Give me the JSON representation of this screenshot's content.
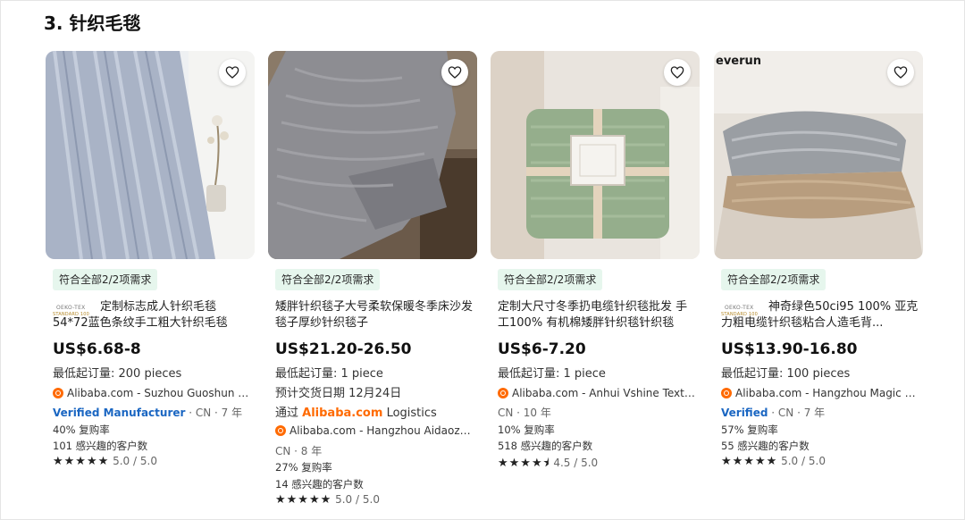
{
  "section_title": "3. 针织毛毯",
  "cards": [
    {
      "match_badge": "符合全部2/2项需求",
      "cert_top": "OEKO-TEX",
      "cert_bottom": "STANDARD 100",
      "title": "定制标志成人针织毛毯 54*72蓝色条纹手工粗大针织毛毯",
      "price": "US$6.68-8",
      "moq": "最低起订量: 200 pieces",
      "supplier": "Alibaba.com - Suzhou Guoshun Te...",
      "verified_label": "Verified Manufacturer",
      "origin": "· CN · 7 年",
      "reorder": "40% 复购率",
      "interested": "101 感兴趣的客户数",
      "stars": "★★★★★",
      "rating": "5.0 / 5.0"
    },
    {
      "match_badge": "符合全部2/2项需求",
      "title": "矮胖针织毯子大号柔软保暖冬季床沙发毯子厚纱针织毯子",
      "price": "US$21.20-26.50",
      "moq": "最低起订量: 1 piece",
      "delivery": "预计交货日期 12月24日",
      "logistics_prefix": "通过",
      "logistics_brand": "Alibaba.com",
      "logistics_suffix": "Logistics",
      "supplier": "Alibaba.com - Hangzhou Aidaozhe...",
      "origin": "CN · 8 年",
      "reorder": "27% 复购率",
      "interested": "14 感兴趣的客户数",
      "stars": "★★★★★",
      "rating": "5.0 / 5.0"
    },
    {
      "match_badge": "符合全部2/2项需求",
      "title": "定制大尺寸冬季扔电缆针织毯批发 手工100% 有机棉矮胖针织毯针织毯",
      "price": "US$6-7.20",
      "moq": "最低起订量: 1 piece",
      "supplier": "Alibaba.com - Anhui Vshine Textile...",
      "origin": "CN · 10 年",
      "reorder": "10% 复购率",
      "interested": "518 感兴趣的客户数",
      "stars": "★★★★⯨",
      "rating": "4.5 / 5.0"
    },
    {
      "match_badge": "符合全部2/2项需求",
      "cert_top": "OEKO-TEX",
      "cert_bottom": "STANDARD 100",
      "image_brand": "everun",
      "title": "神奇绿色50ci95 100% 亚克力粗电缆针织毯粘合人造毛背...",
      "price": "US$13.90-16.80",
      "moq": "最低起订量: 100 pieces",
      "supplier": "Alibaba.com - Hangzhou Magic Gr...",
      "verified_label": "Verified",
      "origin": "· CN · 7 年",
      "reorder": "57% 复购率",
      "interested": "55 感兴趣的客户数",
      "stars": "★★★★★",
      "rating": "5.0 / 5.0"
    }
  ],
  "colors": {
    "match_bg": "#e6f6ed",
    "verified": "#1a66c2",
    "alibaba_orange": "#ff6a00"
  }
}
